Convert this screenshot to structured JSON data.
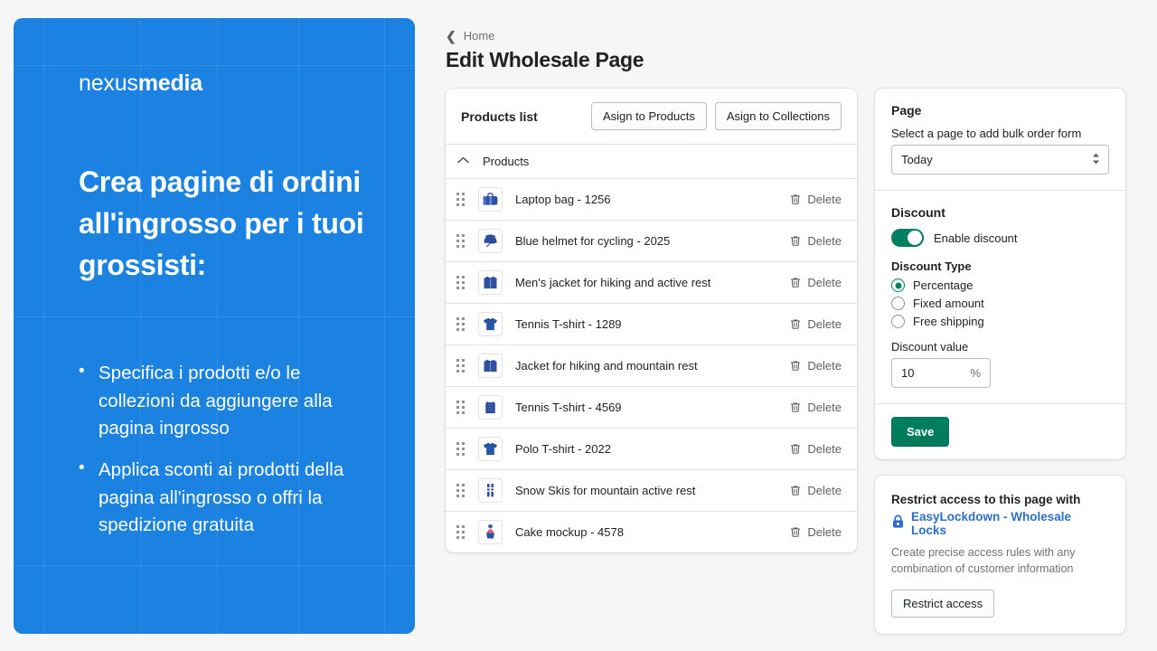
{
  "promo": {
    "logo_light": "nexus",
    "logo_bold": "media",
    "heading": "Crea pagine di ordini all'ingrosso per i tuoi grossisti:",
    "bullets": [
      "Specifica i prodotti e/o le collezioni da aggiungere alla pagina ingrosso",
      "Applica sconti ai prodotti della pagina all'ingrosso o offri la spedizione gratuita"
    ],
    "background_color": "#1b82e2"
  },
  "header": {
    "back_icon": "chevron-left-icon",
    "breadcrumb": "Home",
    "title": "Edit Wholesale Page"
  },
  "products_card": {
    "title": "Products list",
    "assign_products_label": "Asign to Products",
    "assign_collections_label": "Asign to Collections",
    "section_label": "Products",
    "section_caret": "chevron-up-icon",
    "delete_label": "Delete",
    "rows": [
      {
        "name": "Laptop bag - 1256",
        "thumb": "laptop-bag"
      },
      {
        "name": "Blue helmet for cycling - 2025",
        "thumb": "helmet"
      },
      {
        "name": "Men's jacket for hiking and active rest",
        "thumb": "jacket-hoodie"
      },
      {
        "name": "Tennis T-shirt - 1289",
        "thumb": "polo-shirt"
      },
      {
        "name": "Jacket for hiking and mountain rest",
        "thumb": "jacket-hoodie"
      },
      {
        "name": "Tennis T-shirt - 4569",
        "thumb": "tank-top"
      },
      {
        "name": "Polo T-shirt - 2022",
        "thumb": "polo-shirt"
      },
      {
        "name": "Snow Skis for mountain active rest",
        "thumb": "skis"
      },
      {
        "name": "Cake mockup - 4578",
        "thumb": "cake"
      }
    ]
  },
  "page_section": {
    "title": "Page",
    "description": "Select a page to add bulk order form",
    "select_value": "Today",
    "select_icon": "updown-chevron-icon"
  },
  "discount_section": {
    "title": "Discount",
    "toggle_label": "Enable discount",
    "toggle_on": true,
    "toggle_color": "#008060",
    "type_label": "Discount Type",
    "types": [
      {
        "label": "Percentage",
        "selected": true
      },
      {
        "label": "Fixed amount",
        "selected": false
      },
      {
        "label": "Free shipping",
        "selected": false
      }
    ],
    "value_label": "Discount value",
    "value": "10",
    "value_suffix": "%"
  },
  "save": {
    "label": "Save",
    "color": "#008060"
  },
  "lock_card": {
    "title": "Restrict access to this page with",
    "link_icon": "lock-icon",
    "link_text": "EasyLockdown - Wholesale Locks",
    "link_color": "#2c6ecb",
    "description": "Create precise access rules with any combination of customer information",
    "button_label": "Restrict access"
  }
}
